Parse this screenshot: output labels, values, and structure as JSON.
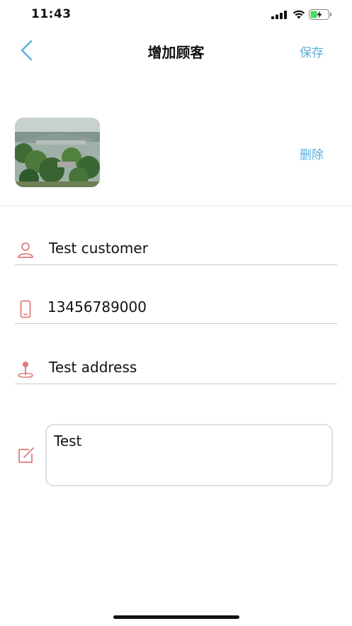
{
  "status_bar": {
    "time": "11:43",
    "icons": [
      "signal-icon",
      "wifi-icon",
      "battery-charging-icon"
    ],
    "battery_color": "#4cd964"
  },
  "nav": {
    "back_icon": "chevron-left-icon",
    "title": "增加顾客",
    "save_label": "保存"
  },
  "photo": {
    "description_icon": "photo-thumbnail",
    "delete_label": "删除"
  },
  "form": {
    "name": {
      "icon": "person-icon",
      "value": "Test customer"
    },
    "phone": {
      "icon": "phone-icon",
      "value": "13456789000"
    },
    "address": {
      "icon": "location-pin-icon",
      "value": "Test address"
    },
    "notes": {
      "icon": "edit-note-icon",
      "value": "Test"
    }
  },
  "colors": {
    "accent": "#5aaee0",
    "icon": "#e07a7a",
    "divider": "#c9c9c9"
  }
}
